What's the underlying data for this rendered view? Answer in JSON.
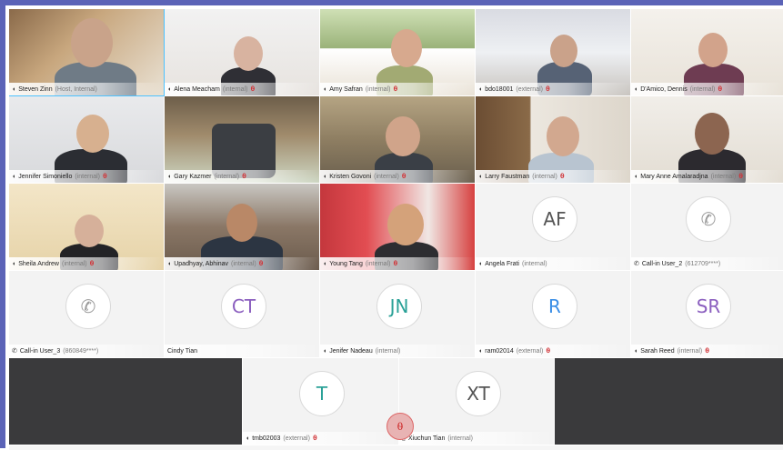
{
  "colors": {
    "accent": "#5b63b7",
    "active_speaker": "#4cc2ff",
    "mute": "#d13438",
    "initials_purple": "#8b5fbf",
    "initials_teal": "#2aa197",
    "initials_blue": "#3a8ee6",
    "initials_gray": "#555555"
  },
  "participants": [
    {
      "name": "Steven Zinn",
      "tag": "(Host, Internal)",
      "muted": false,
      "active": true
    },
    {
      "name": "Alena Meacham",
      "tag": "(internal)",
      "muted": true
    },
    {
      "name": "Amy Safran",
      "tag": "(internal)",
      "muted": true
    },
    {
      "name": "bdo18001",
      "tag": "(external)",
      "muted": true
    },
    {
      "name": "D'Amico, Dennis",
      "tag": "(internal)",
      "muted": true
    },
    {
      "name": "Jennifer Simoniello",
      "tag": "(internal)",
      "muted": true
    },
    {
      "name": "Gary Kazmer",
      "tag": "(internal)",
      "muted": true
    },
    {
      "name": "Kristen Govoni",
      "tag": "(internal)",
      "muted": true
    },
    {
      "name": "Larry Faustman",
      "tag": "(internal)",
      "muted": true
    },
    {
      "name": "Mary Anne Amalaradjna",
      "tag": "(internal)",
      "muted": true
    },
    {
      "name": "Sheila Andrew",
      "tag": "(internal)",
      "muted": true
    },
    {
      "name": "Upadhyay, Abhinav",
      "tag": "(internal)",
      "muted": true
    },
    {
      "name": "Young Tang",
      "tag": "(internal)",
      "muted": true
    },
    {
      "name": "Angela Frati",
      "tag": "(internal)",
      "initials": "AF",
      "muted": false
    },
    {
      "name": "Call-in User_2",
      "tag": "(612709****)",
      "phone": true,
      "muted": false
    },
    {
      "name": "Call-in User_3",
      "tag": "(860849****)",
      "phone": true,
      "muted": false
    },
    {
      "name": "Cindy Tian",
      "tag": "",
      "initials": "CT",
      "muted": false
    },
    {
      "name": "Jenifer Nadeau",
      "tag": "(internal)",
      "initials": "JN",
      "muted": false
    },
    {
      "name": "ram02014",
      "tag": "(external)",
      "initials": "R",
      "muted": true
    },
    {
      "name": "Sarah Reed",
      "tag": "(internal)",
      "initials": "SR",
      "muted": true
    },
    {
      "name": "tmb02003",
      "tag": "(external)",
      "initials": "T",
      "muted": true
    },
    {
      "name": "Xiuchun Tian",
      "tag": "(internal)",
      "initials": "XT",
      "muted": false
    }
  ],
  "icons": {
    "speaker": "speaker-icon",
    "mic_off": "mic-off-icon",
    "phone": "phone-icon"
  }
}
